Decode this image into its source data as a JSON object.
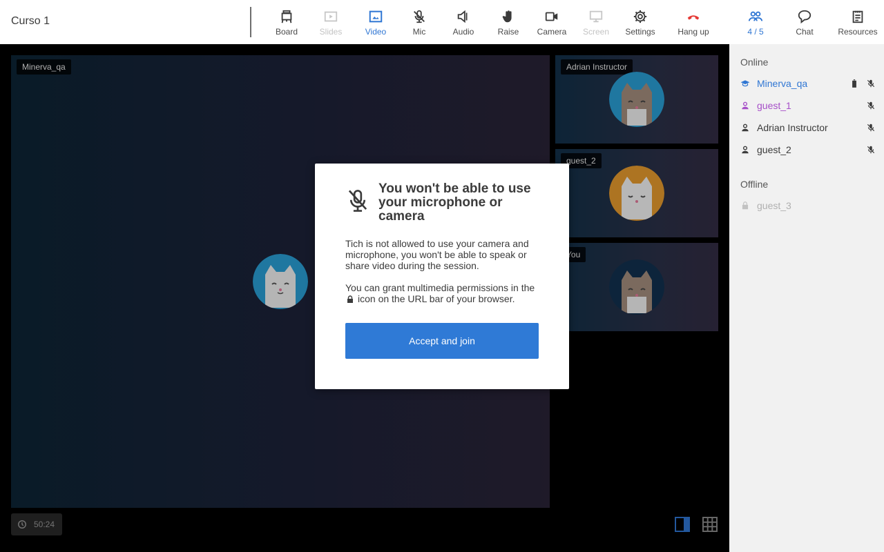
{
  "header": {
    "course_title": "Curso 1",
    "toolbar": [
      {
        "id": "board",
        "label": "Board",
        "icon": "whiteboard-icon",
        "state": "normal"
      },
      {
        "id": "slides",
        "label": "Slides",
        "icon": "slides-icon",
        "state": "disabled"
      },
      {
        "id": "video",
        "label": "Video",
        "icon": "video-layout-icon",
        "state": "active"
      },
      {
        "id": "mic",
        "label": "Mic",
        "icon": "mic-off-icon",
        "state": "normal"
      },
      {
        "id": "audio",
        "label": "Audio",
        "icon": "speaker-icon",
        "state": "normal"
      },
      {
        "id": "raise",
        "label": "Raise",
        "icon": "hand-icon",
        "state": "normal"
      },
      {
        "id": "camera",
        "label": "Camera",
        "icon": "camera-icon",
        "state": "normal"
      },
      {
        "id": "screen",
        "label": "Screen",
        "icon": "screen-share-icon",
        "state": "disabled"
      },
      {
        "id": "settings",
        "label": "Settings",
        "icon": "gear-icon",
        "state": "normal"
      },
      {
        "id": "hangup",
        "label": "Hang up",
        "icon": "phone-hangup-icon",
        "state": "danger"
      }
    ]
  },
  "side_tabs": [
    {
      "id": "participants",
      "label": "4 / 5",
      "icon": "people-icon",
      "state": "active"
    },
    {
      "id": "chat",
      "label": "Chat",
      "icon": "chat-bubble-icon",
      "state": "normal"
    },
    {
      "id": "resources",
      "label": "Resources",
      "icon": "clipboard-icon",
      "state": "normal"
    }
  ],
  "participants": {
    "online_title": "Online",
    "offline_title": "Offline",
    "online": [
      {
        "name": "Minerva_qa",
        "role": "teacher",
        "color": "#2f76d3",
        "icons": [
          "trash-icon",
          "mic-off-icon"
        ]
      },
      {
        "name": "guest_1",
        "role": "guest",
        "color": "#a64fc8",
        "icons": [
          "mic-off-icon"
        ]
      },
      {
        "name": "Adrian Instructor",
        "role": "guest",
        "color": "#3b3b3b",
        "icons": [
          "mic-off-icon"
        ]
      },
      {
        "name": "guest_2",
        "role": "guest",
        "color": "#3b3b3b",
        "icons": [
          "mic-off-icon"
        ]
      }
    ],
    "offline": [
      {
        "name": "guest_3",
        "role": "offline",
        "color": "#b0b0b0",
        "icons": []
      }
    ]
  },
  "videos": {
    "main_label": "Minerva_qa",
    "tiles": [
      {
        "label": "Adrian Instructor",
        "avatar": "cat-avatar-blue"
      },
      {
        "label": "guest_2",
        "avatar": "cat-avatar-orange"
      },
      {
        "label": "You",
        "avatar": "cat-avatar-navy"
      }
    ]
  },
  "modal": {
    "title": "You won't be able to use your microphone or camera",
    "para1": "Tich is not allowed to use your camera and microphone, you won't be able to speak or share video during the session.",
    "para2_before": "You can grant multimedia permissions in the",
    "para2_after": "icon on the URL bar of your browser.",
    "accept_label": "Accept and join"
  },
  "footer": {
    "timer": "50:24"
  },
  "colors": {
    "accent": "#2f76d3",
    "hangup": "#e53935",
    "guest_purple": "#a64fc8"
  }
}
